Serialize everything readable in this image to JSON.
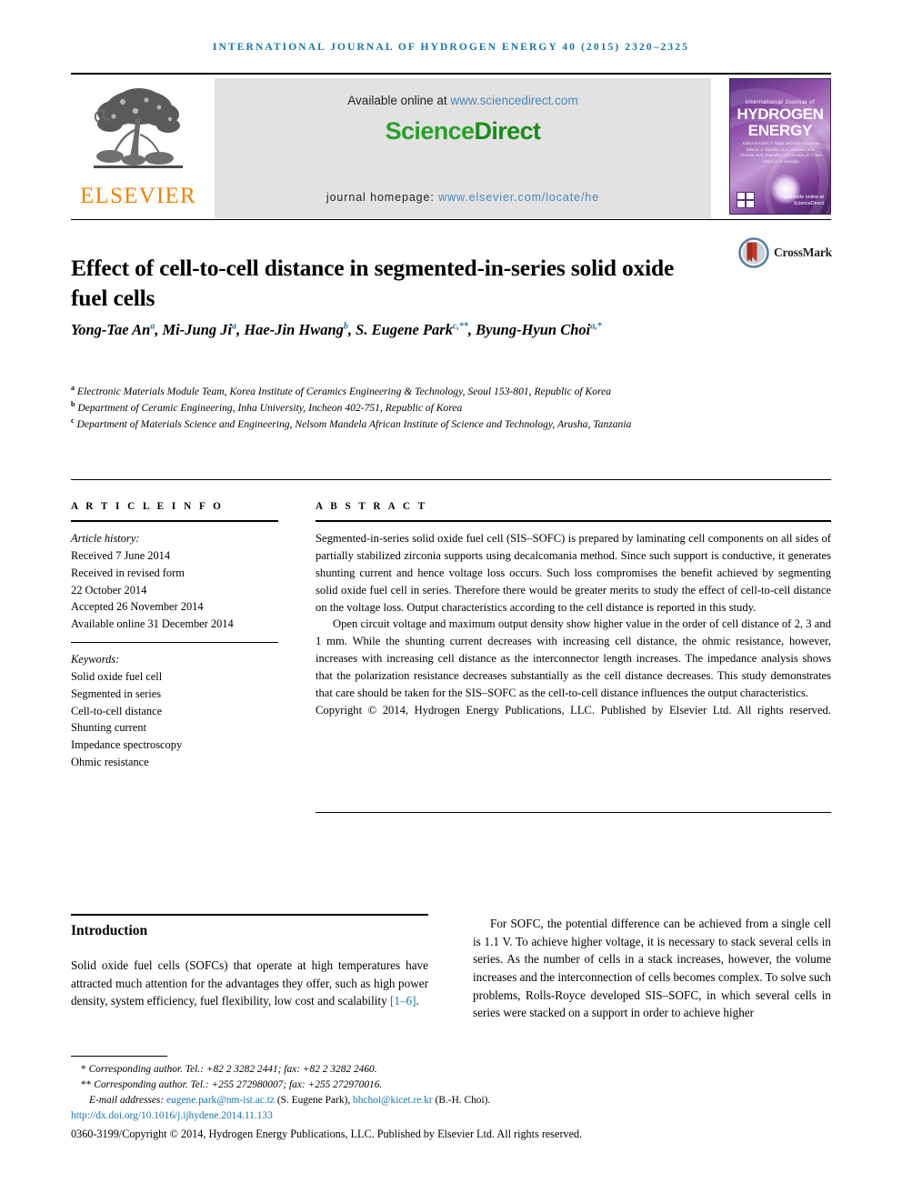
{
  "running_head": "INTERNATIONAL JOURNAL OF HYDROGEN ENERGY 40 (2015) 2320–2325",
  "masthead": {
    "publisher_name": "ELSEVIER",
    "available_label": "Available online at ",
    "available_url": "www.sciencedirect.com",
    "logo_part1": "Science",
    "logo_part2": "Direct",
    "homepage_label": "journal homepage: ",
    "homepage_url": "www.elsevier.com/locate/he",
    "cover": {
      "line_small": "International Journal of",
      "line1": "HYDROGEN",
      "line2": "ENERGY",
      "editors": "Editor-in-Chief: T. Nejat Veziroğlu   Associate Editors: A. Bashkin, K.C. Gardner, M.R. Almeida, M.D. Mamalis, J.M. Bockris, E.-I. Bar-Yosef, C.V. Hellasğu",
      "sciencedirect_note": "Available online at\nScienceDirect"
    }
  },
  "article": {
    "title": "Effect of cell-to-cell distance in segmented-in-series solid oxide fuel cells",
    "crossmark_label": "CrossMark",
    "authors": [
      {
        "name": "Yong-Tae An",
        "sup": "a",
        "sep": ", "
      },
      {
        "name": "Mi-Jung Ji",
        "sup": "a",
        "sep": ", "
      },
      {
        "name": "Hae-Jin Hwang",
        "sup": "b",
        "sep": ", "
      },
      {
        "name": "S. Eugene Park",
        "sup": "c,**",
        "sep": ", "
      },
      {
        "name": "Byung-Hyun Choi",
        "sup": "a,*",
        "sep": ""
      }
    ],
    "affiliations": [
      {
        "marker": "a",
        "text": "Electronic Materials Module Team, Korea Institute of Ceramics Engineering & Technology, Seoul 153-801, Republic of Korea"
      },
      {
        "marker": "b",
        "text": "Department of Ceramic Engineering, Inha University, Incheon 402-751, Republic of Korea"
      },
      {
        "marker": "c",
        "text": "Department of Materials Science and Engineering, Nelsom Mandela African Institute of Science and Technology, Arusha, Tanzania"
      }
    ]
  },
  "article_info": {
    "heading": "A R T I C L E   I N F O",
    "history_label": "Article history:",
    "history": [
      "Received 7 June 2014",
      "Received in revised form",
      "22 October 2014",
      "Accepted 26 November 2014",
      "Available online 31 December 2014"
    ],
    "keywords_label": "Keywords:",
    "keywords": [
      "Solid oxide fuel cell",
      "Segmented in series",
      "Cell-to-cell distance",
      "Shunting current",
      "Impedance spectroscopy",
      "Ohmic resistance"
    ]
  },
  "abstract": {
    "heading": "A B S T R A C T",
    "paragraph1": "Segmented-in-series solid oxide fuel cell (SIS–SOFC) is prepared by laminating cell components on all sides of partially stabilized zirconia supports using decalcomania method. Since such support is conductive, it generates shunting current and hence voltage loss occurs. Such loss compromises the benefit achieved by segmenting solid oxide fuel cell in series. Therefore there would be greater merits to study the effect of cell-to-cell distance on the voltage loss. Output characteristics according to the cell distance is reported in this study.",
    "paragraph2": "Open circuit voltage and maximum output density show higher value in the order of cell distance of 2, 3 and 1 mm. While the shunting current decreases with increasing cell distance, the ohmic resistance, however, increases with increasing cell distance as the interconnector length increases. The impedance analysis shows that the polarization resistance decreases substantially as the cell distance decreases. This study demonstrates that care should be taken for the SIS–SOFC as the cell-to-cell distance influences the output characteristics.",
    "copyright": "Copyright © 2014, Hydrogen Energy Publications, LLC. Published by Elsevier Ltd. All rights reserved."
  },
  "body": {
    "section_title": "Introduction",
    "left_column": "Solid oxide fuel cells (SOFCs) that operate at high temperatures have attracted much attention for the advantages they offer, such as high power density, system efficiency, fuel flexibility, low cost and scalability ",
    "left_citation": "[1–6]",
    "left_column_tail": ".",
    "right_column": "For SOFC, the potential difference can be achieved from a single cell is 1.1 V. To achieve higher voltage, it is necessary to stack several cells in series. As the number of cells in a stack increases, however, the volume increases and the interconnection of cells becomes complex. To solve such problems, Rolls-Royce developed SIS–SOFC, in which several cells in series were stacked on a support in order to achieve higher"
  },
  "footnotes": {
    "corresponding1": "Corresponding author. Tel.: +82 2 3282 2441; fax: +82 2 3282 2460.",
    "corresponding1_marker": "*",
    "corresponding2": "Corresponding author. Tel.: +255 272980007; fax: +255 272970016.",
    "corresponding2_marker": "**",
    "email_label": "E-mail addresses: ",
    "email1": "eugene.park@nm-ist.ac.tz",
    "email1_owner": " (S. Eugene Park), ",
    "email2": "bhchoi@kicet.re.kr",
    "email2_owner": " (B.-H. Choi).",
    "doi": "http://dx.doi.org/10.1016/j.ijhydene.2014.11.133",
    "copyright": "0360-3199/Copyright © 2014, Hydrogen Energy Publications, LLC. Published by Elsevier Ltd. All rights reserved."
  },
  "colors": {
    "link": "#1573a8",
    "elsevier_orange": "#ef8200",
    "sciencedirect_green": "#2aa02a",
    "banner_gray": "#e2e2e2"
  }
}
